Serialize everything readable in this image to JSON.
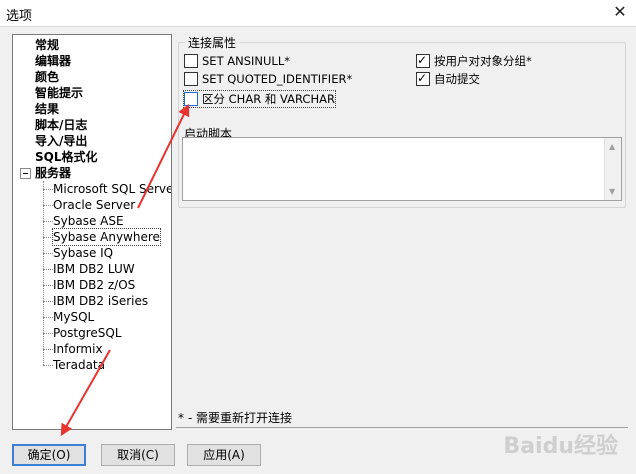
{
  "window": {
    "title": "选项",
    "close_glyph": "✕"
  },
  "tree": {
    "items": [
      "常规",
      "编辑器",
      "颜色",
      "智能提示",
      "结果",
      "脚本/日志",
      "导入/导出",
      "SQL格式化",
      "服务器"
    ],
    "servers": [
      "Microsoft SQL Server",
      "Oracle Server",
      "Sybase ASE",
      "Sybase Anywhere",
      "Sybase IQ",
      "IBM DB2 LUW",
      "IBM DB2 z/OS",
      "IBM DB2 iSeries",
      "MySQL",
      "PostgreSQL",
      "Informix",
      "Teradata"
    ],
    "selected": "Sybase Anywhere"
  },
  "connection": {
    "legend": "连接属性",
    "options": [
      {
        "label": "SET ANSINULL*",
        "checked": false
      },
      {
        "label": "SET QUOTED_IDENTIFIER*",
        "checked": false
      },
      {
        "label": "区分 CHAR 和 VARCHAR",
        "checked": false
      },
      {
        "label": "按用户对对象分组*",
        "checked": true
      },
      {
        "label": "自动提交",
        "checked": true
      }
    ]
  },
  "startup_script": {
    "label": "启动脚本",
    "value": ""
  },
  "footer": {
    "note": "* - 需要重新打开连接"
  },
  "buttons": {
    "ok": "确定(O)",
    "cancel": "取消(C)",
    "apply": "应用(A)"
  },
  "watermark": "Baidu经验",
  "colors": {
    "arrow": "#e8332e",
    "default_button_border": "#3c7fd4"
  }
}
